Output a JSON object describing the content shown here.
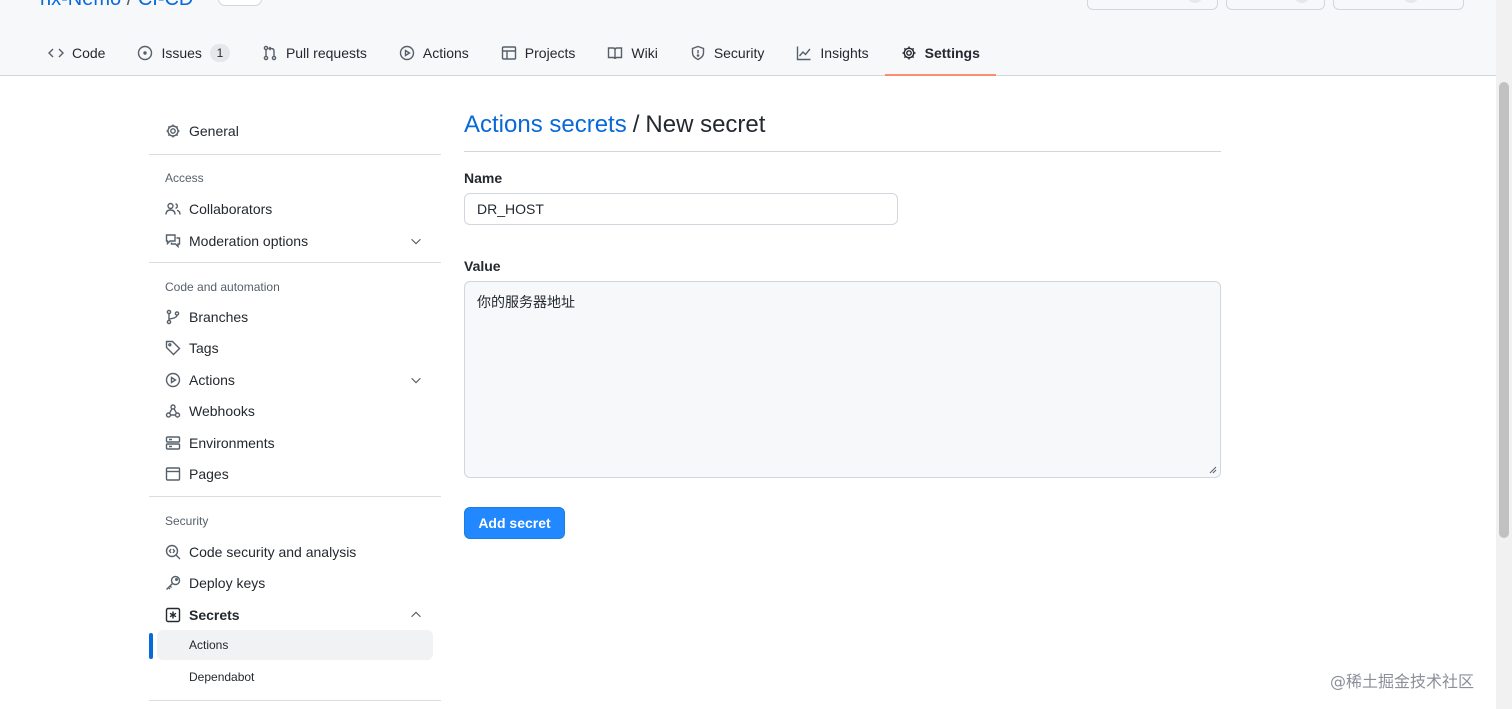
{
  "header": {
    "repo_owner": "nx-Nemo",
    "repo_sep": "/",
    "repo_name": "CI-CD"
  },
  "tabs": [
    {
      "label": "Code",
      "icon": "code-icon"
    },
    {
      "label": "Issues",
      "icon": "issue-opened-icon",
      "counter": "1"
    },
    {
      "label": "Pull requests",
      "icon": "git-pull-request-icon"
    },
    {
      "label": "Actions",
      "icon": "play-icon"
    },
    {
      "label": "Projects",
      "icon": "table-icon"
    },
    {
      "label": "Wiki",
      "icon": "book-icon"
    },
    {
      "label": "Security",
      "icon": "shield-icon"
    },
    {
      "label": "Insights",
      "icon": "graph-icon"
    },
    {
      "label": "Settings",
      "icon": "gear-icon",
      "selected": true
    }
  ],
  "sidebar": {
    "general": "General",
    "access_heading": "Access",
    "collaborators": "Collaborators",
    "moderation": "Moderation options",
    "code_heading": "Code and automation",
    "branches": "Branches",
    "tags": "Tags",
    "actions": "Actions",
    "webhooks": "Webhooks",
    "environments": "Environments",
    "pages": "Pages",
    "security_heading": "Security",
    "code_security": "Code security and analysis",
    "deploy_keys": "Deploy keys",
    "secrets": "Secrets",
    "secrets_actions": "Actions",
    "secrets_dependabot": "Dependabot"
  },
  "main": {
    "heading_link": "Actions secrets",
    "heading_sep": "/",
    "heading_current": "New secret",
    "name_label": "Name",
    "name_value": "DR_HOST",
    "value_label": "Value",
    "value_text": "你的服务器地址",
    "submit_label": "Add secret"
  },
  "colors": {
    "link": "#0969da",
    "primary_button": "#2188ff",
    "selected_tab_underline": "#fd8c73"
  },
  "watermark": "@稀土掘金技术社区"
}
